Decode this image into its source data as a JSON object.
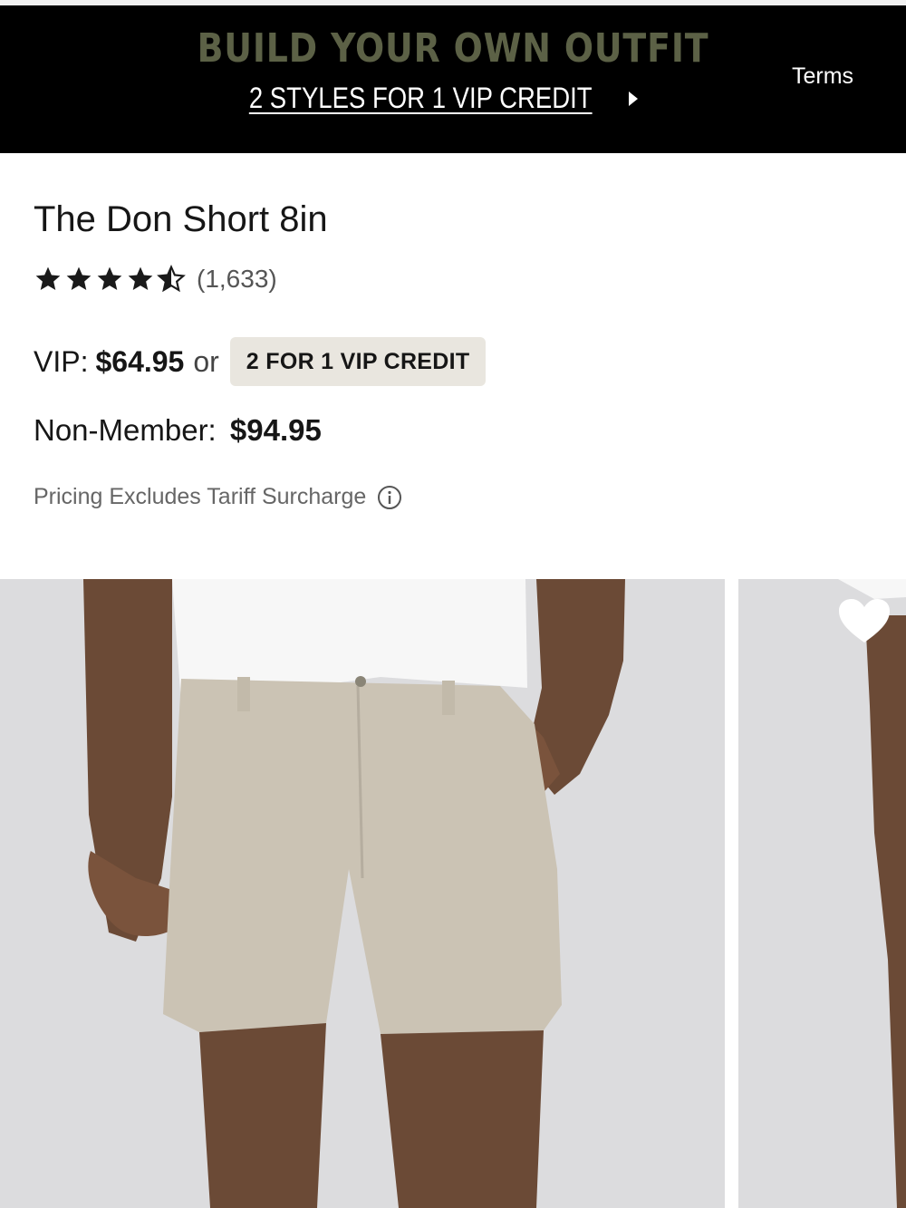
{
  "promo": {
    "headline": "BUILD YOUR OWN OUTFIT",
    "subline": "2 STYLES FOR 1 VIP CREDIT",
    "terms_label": "Terms",
    "headline_color": "#5c6146"
  },
  "product": {
    "title": "The Don Short 8in",
    "rating": 4.5,
    "rating_max": 5,
    "review_count": "(1,633)",
    "vip_label": "VIP:",
    "vip_price": "$64.95",
    "or_text": "or",
    "credit_badge": "2 FOR 1 VIP CREDIT",
    "nonmember_label": "Non-Member:",
    "nonmember_price": "$94.95",
    "tariff_note": "Pricing Excludes Tariff Surcharge"
  },
  "icons": {
    "star": "star-icon",
    "info": "info-icon",
    "arrow": "caret-right-icon",
    "wishlist": "heart-icon"
  },
  "colors": {
    "banner_bg": "#000000",
    "badge_bg": "#e9e6df",
    "photo_bg": "#dcdcde",
    "shorts": "#cbc3b4"
  }
}
